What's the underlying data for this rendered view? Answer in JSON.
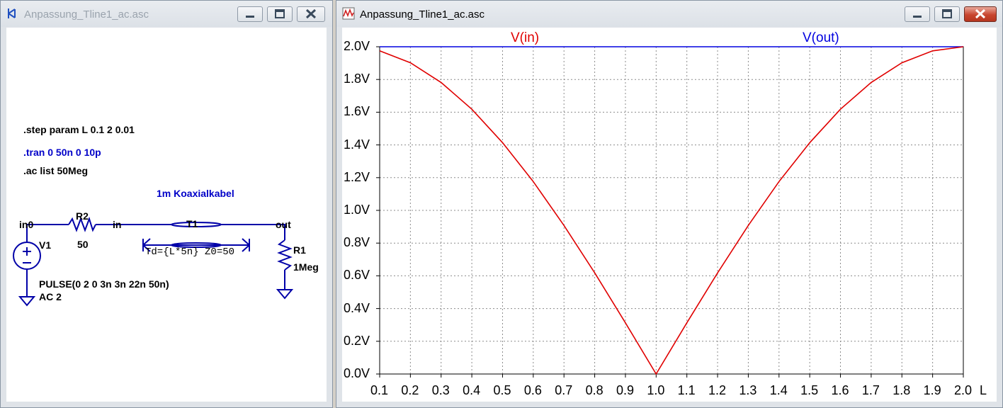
{
  "schematic_window": {
    "title": "Anpassung_Tline1_ac.asc",
    "directives": {
      "step": ".step param L 0.1 2 0.01",
      "tran": ".tran 0 50n 0 10p",
      "ac": ".ac list 50Meg"
    },
    "cable_comment": "1m Koaxialkabel",
    "nets": {
      "in0": "in0",
      "in": "in",
      "out": "out"
    },
    "components": {
      "v1": {
        "name": "V1",
        "value": "PULSE(0 2 0 3n 3n 22n 50n)",
        "ac": "AC 2"
      },
      "r2": {
        "name": "R2",
        "value": "50"
      },
      "t1": {
        "name": "T1",
        "value": "Td={L*5n} Z0=50"
      },
      "r1": {
        "name": "R1",
        "value": "1Meg"
      }
    }
  },
  "plot_window": {
    "title": "Anpassung_Tline1_ac.asc"
  },
  "colors": {
    "vin": "#e00000",
    "vout": "#0000e0",
    "grid": "#8c8c8c",
    "wire": "#0000a8"
  },
  "chart_data": {
    "type": "line",
    "xlabel": "L",
    "ylabel": "",
    "xlim": [
      0.1,
      2.0
    ],
    "ylim": [
      0.0,
      2.0
    ],
    "xticks": [
      "0.1",
      "0.2",
      "0.3",
      "0.4",
      "0.5",
      "0.6",
      "0.7",
      "0.8",
      "0.9",
      "1.0",
      "1.1",
      "1.2",
      "1.3",
      "1.4",
      "1.5",
      "1.6",
      "1.7",
      "1.8",
      "1.9",
      "2.0"
    ],
    "yticks": [
      "0.0V",
      "0.2V",
      "0.4V",
      "0.6V",
      "0.8V",
      "1.0V",
      "1.2V",
      "1.4V",
      "1.6V",
      "1.8V",
      "2.0V"
    ],
    "grid": true,
    "grid_style": "dotted",
    "series": [
      {
        "name": "V(in)",
        "color": "#e00000",
        "x": [
          0.1,
          0.2,
          0.3,
          0.4,
          0.5,
          0.6,
          0.7,
          0.8,
          0.9,
          1.0,
          1.1,
          1.2,
          1.3,
          1.4,
          1.5,
          1.6,
          1.7,
          1.8,
          1.9,
          2.0
        ],
        "y": [
          1.975,
          1.902,
          1.782,
          1.618,
          1.414,
          1.176,
          0.908,
          0.618,
          0.313,
          0.0,
          0.313,
          0.618,
          0.908,
          1.176,
          1.414,
          1.618,
          1.782,
          1.902,
          1.975,
          2.0
        ]
      },
      {
        "name": "V(out)",
        "color": "#0000e0",
        "x": [
          0.1,
          2.0
        ],
        "y": [
          2.0,
          2.0
        ]
      }
    ]
  }
}
